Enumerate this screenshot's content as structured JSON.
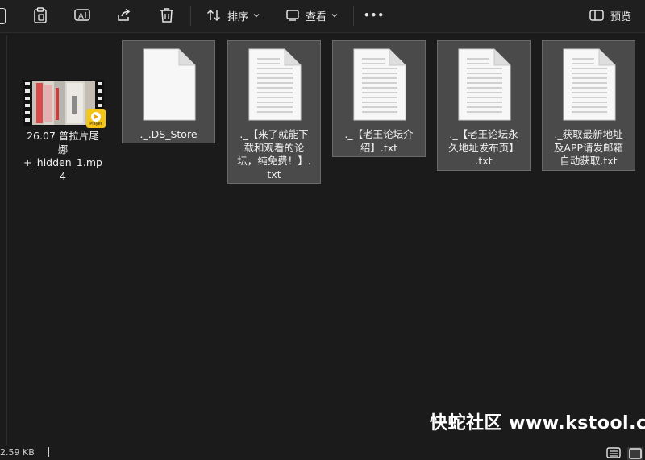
{
  "toolbar": {
    "sort_label": "排序",
    "view_label": "查看",
    "more_label": "•••",
    "preview_label": "预览"
  },
  "files": [
    {
      "name": "26.07 普拉片尾\n娜\n+_hidden_1.mp\n4",
      "type": "video",
      "badge": "Player"
    },
    {
      "name": "._.DS_Store",
      "type": "blank"
    },
    {
      "name": "._【来了就能下\n载和观看的论\n坛，纯免费！】.\ntxt",
      "type": "text"
    },
    {
      "name": "._【老王论坛介\n绍】.txt",
      "type": "text"
    },
    {
      "name": "._【老王论坛永\n久地址发布页】\n.txt",
      "type": "text"
    },
    {
      "name": "._获取最新地址\n及APP请发邮箱\n自动获取.txt",
      "type": "text"
    }
  ],
  "status": {
    "size": "2.59 KB"
  },
  "watermark": "快蛇社区 www.kstool.cc",
  "colors": {
    "background": "#1b1b1b",
    "selection": "#4a4a4a",
    "badge": "#f5c518"
  }
}
